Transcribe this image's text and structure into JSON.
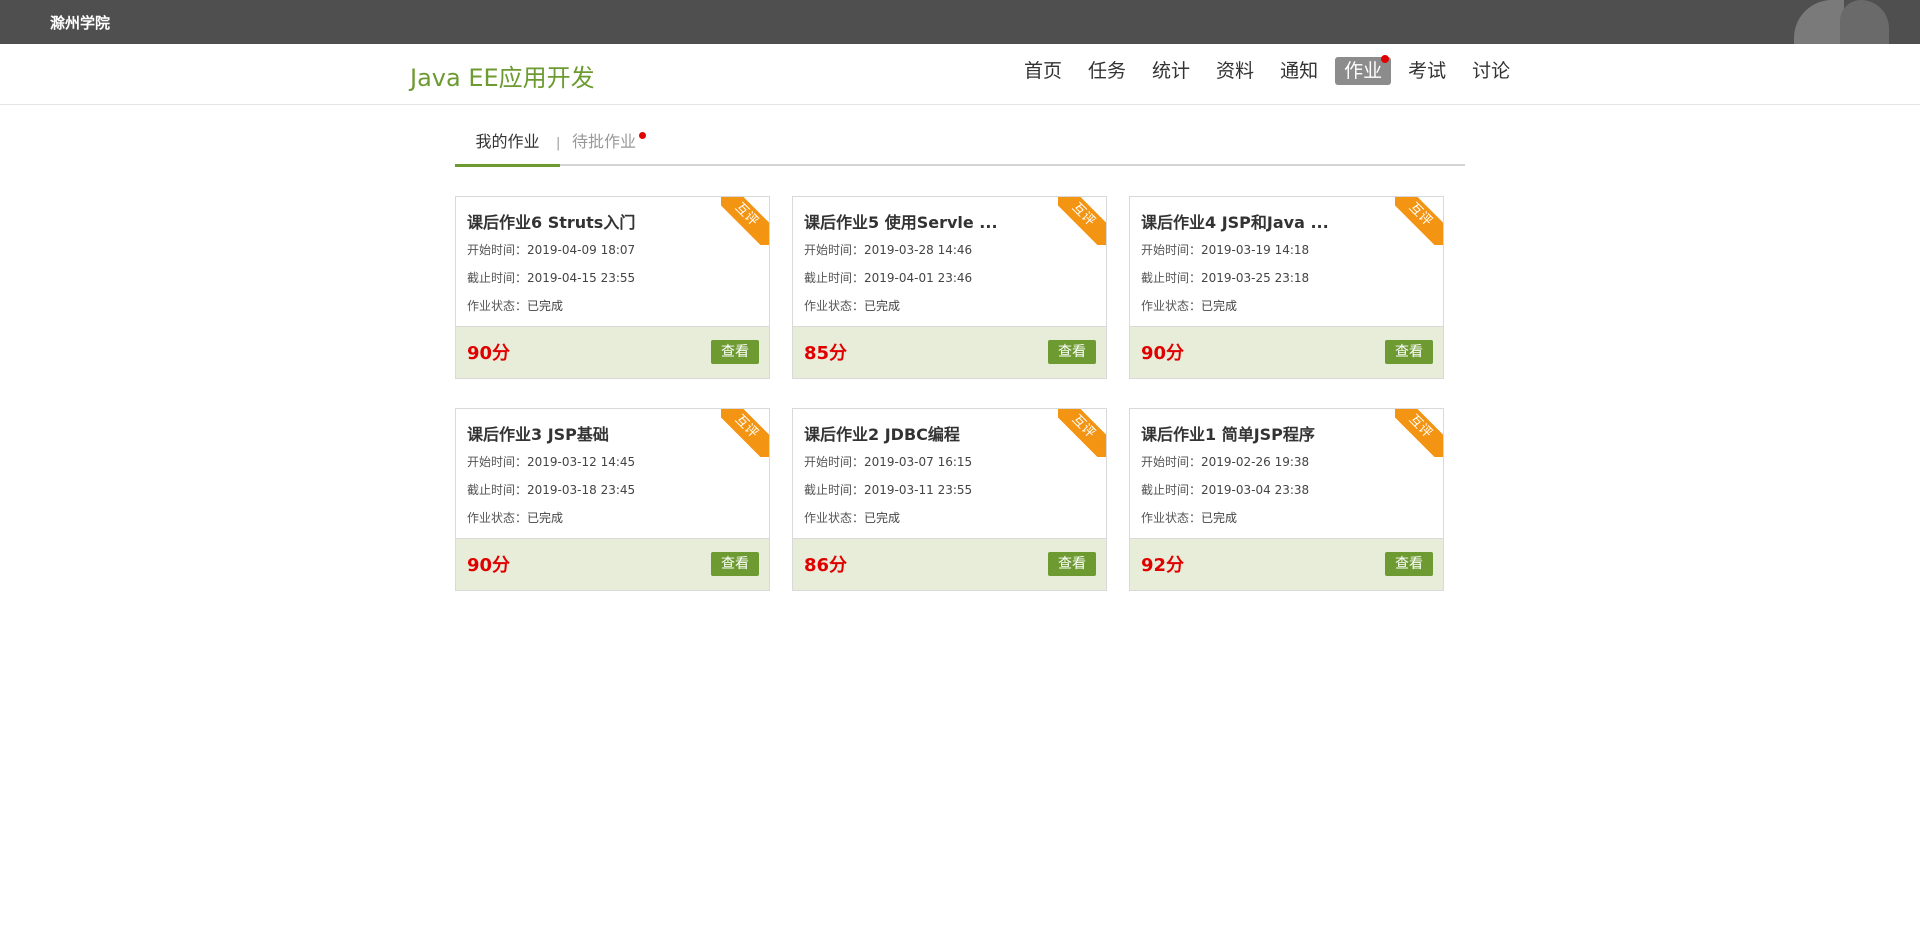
{
  "topbar": {
    "school_name": "滁州学院"
  },
  "course": {
    "title": "Java EE应用开发"
  },
  "nav": [
    {
      "label": "首页",
      "active": false,
      "dot": false
    },
    {
      "label": "任务",
      "active": false,
      "dot": false
    },
    {
      "label": "统计",
      "active": false,
      "dot": false
    },
    {
      "label": "资料",
      "active": false,
      "dot": false
    },
    {
      "label": "通知",
      "active": false,
      "dot": false
    },
    {
      "label": "作业",
      "active": true,
      "dot": true
    },
    {
      "label": "考试",
      "active": false,
      "dot": false
    },
    {
      "label": "讨论",
      "active": false,
      "dot": false
    }
  ],
  "tabs": {
    "mine": "我的作业",
    "separator": "|",
    "pending": "待批作业"
  },
  "card_labels": {
    "start": "开始时间：",
    "end": "截止时间：",
    "status": "作业状态：",
    "view": "查看",
    "ribbon": "互评"
  },
  "assignments": [
    {
      "title": "课后作业6 Struts入门",
      "start": "2019-04-09 18:07",
      "end": "2019-04-15 23:55",
      "status": "已完成",
      "score": "90分"
    },
    {
      "title": "课后作业5 使用Servle ...",
      "start": "2019-03-28 14:46",
      "end": "2019-04-01 23:46",
      "status": "已完成",
      "score": "85分"
    },
    {
      "title": "课后作业4 JSP和Java ...",
      "start": "2019-03-19 14:18",
      "end": "2019-03-25 23:18",
      "status": "已完成",
      "score": "90分"
    },
    {
      "title": "课后作业3 JSP基础",
      "start": "2019-03-12 14:45",
      "end": "2019-03-18 23:45",
      "status": "已完成",
      "score": "90分"
    },
    {
      "title": "课后作业2 JDBC编程",
      "start": "2019-03-07 16:15",
      "end": "2019-03-11 23:55",
      "status": "已完成",
      "score": "86分"
    },
    {
      "title": "课后作业1 简单JSP程序",
      "start": "2019-02-26 19:38",
      "end": "2019-03-04 23:38",
      "status": "已完成",
      "score": "92分"
    }
  ],
  "colors": {
    "accent": "#6d9b32",
    "score": "#e00000",
    "ribbon": "#f39412",
    "footer": "#e8edda",
    "topbar": "#4f4f4f"
  }
}
